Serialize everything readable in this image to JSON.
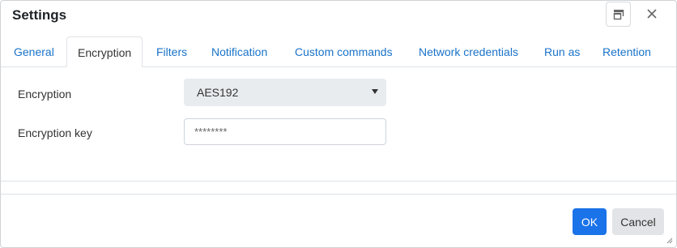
{
  "dialog": {
    "title": "Settings",
    "restore_icon": "restore-window-icon",
    "close_icon": "close-icon"
  },
  "tabs": [
    {
      "label": "General",
      "active": false
    },
    {
      "label": "Encryption",
      "active": true
    },
    {
      "label": "Filters",
      "active": false
    },
    {
      "label": "Notification",
      "active": false
    },
    {
      "label": "Custom commands",
      "active": false
    },
    {
      "label": "Network credentials",
      "active": false
    },
    {
      "label": "Run as",
      "active": false
    },
    {
      "label": "Retention",
      "active": false
    }
  ],
  "form": {
    "encryption_label": "Encryption",
    "encryption_value": "AES192",
    "key_label": "Encryption key",
    "key_value": "********"
  },
  "footer": {
    "ok_label": "OK",
    "cancel_label": "Cancel"
  },
  "colors": {
    "link": "#1a73c9",
    "primary": "#1a73e8",
    "select_bg": "#e9ecef"
  }
}
